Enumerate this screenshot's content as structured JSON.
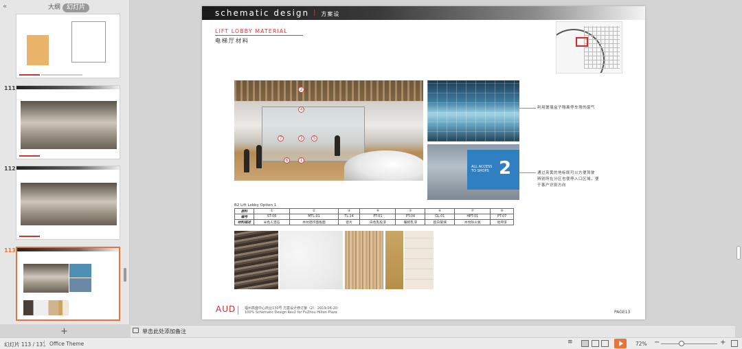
{
  "left_panel": {
    "collapse": "«",
    "tab_outline": "大纲",
    "tab_slides": "幻灯片",
    "thumb_numbers": [
      "111",
      "112",
      "113"
    ],
    "add_slide": "+"
  },
  "slide": {
    "title_main": "schematic design",
    "title_bar": "I",
    "title_cn": "方案设",
    "subtitle_en": "LIFT LOBBY MATERIAL",
    "subtitle_cn": "电梯厅材料",
    "note_top": "利用玻璃盒子隔离停车场的废气",
    "note_bottom_1": "通过亮黄的地标既可以方便驾驶",
    "note_bottom_2": "辨别所在分区也使停入口区域，便",
    "note_bottom_3": "于客户识别方向",
    "sign_text_1": "ALL ACCESS",
    "sign_text_2": "TO SHOPS",
    "sign_num": "2",
    "table_title": "B2 Lift Lobby Option 1",
    "table": {
      "row_labels": [
        "原料",
        "编号",
        "材料描述"
      ],
      "circled": [
        "①",
        "②",
        "③",
        "④",
        "⑤",
        "⑥",
        "⑦",
        "⑧"
      ],
      "codes": [
        "ST-06",
        "MTL-01",
        "TL-14",
        "PT-01",
        "PT-04",
        "GL-01",
        "HPT-01",
        "PT-07"
      ],
      "descriptions": [
        "米色人造石",
        "木纹铝印面板面",
        "瓷片",
        "白色乳胶漆",
        "暖棕乳漆",
        "超白玻璃",
        "木纹防火板",
        "地坪漆"
      ]
    },
    "callouts": [
      "2",
      "4",
      "7",
      "3",
      "5",
      "6",
      "1"
    ],
    "logo": "AUD",
    "footer_line1": "福州高盛中心商业130号 方案设计修订第（2）  2019-06-20",
    "footer_line2": "100% Schematic Design Rev2  for FuZhou Hilton Plaza",
    "page_label": "PAGE13"
  },
  "notes_bar": {
    "placeholder": "单击此处添加备注"
  },
  "status": {
    "slide_counter": "幻灯片 113 / 131",
    "theme": "Office Theme",
    "zoom": "72%",
    "zoom_minus": "−",
    "zoom_plus": "+",
    "notes_toggle": "≡"
  },
  "colors": {
    "accent": "#e4763b",
    "brand_red": "#cc2929"
  }
}
